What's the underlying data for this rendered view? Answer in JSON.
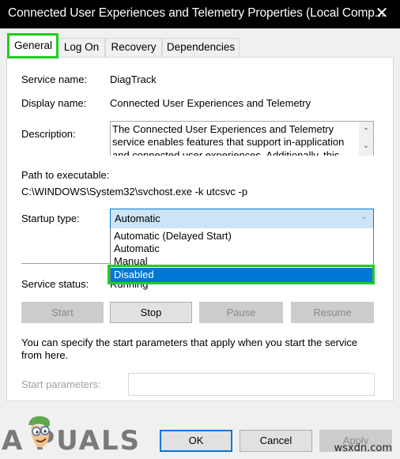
{
  "window": {
    "title": "Connected User Experiences and Telemetry Properties (Local Comp...",
    "close_icon": "close-icon"
  },
  "tabs": [
    {
      "label": "General",
      "active": true
    },
    {
      "label": "Log On",
      "active": false
    },
    {
      "label": "Recovery",
      "active": false
    },
    {
      "label": "Dependencies",
      "active": false
    }
  ],
  "general": {
    "service_name_label": "Service name:",
    "service_name_value": "DiagTrack",
    "display_name_label": "Display name:",
    "display_name_value": "Connected User Experiences and Telemetry",
    "description_label": "Description:",
    "description_value": "The Connected User Experiences and Telemetry service enables features that support in-application and connected user experiences. Additionally, this",
    "path_label": "Path to executable:",
    "path_value": "C:\\WINDOWS\\System32\\svchost.exe -k utcsvc -p",
    "startup_type_label": "Startup type:",
    "startup_type_value": "Automatic",
    "startup_options": [
      {
        "label": "Automatic (Delayed Start)",
        "selected": false
      },
      {
        "label": "Automatic",
        "selected": false
      },
      {
        "label": "Manual",
        "selected": false
      },
      {
        "label": "Disabled",
        "selected": true
      }
    ],
    "service_status_label": "Service status:",
    "service_status_value": "Running",
    "buttons": {
      "start": "Start",
      "stop": "Stop",
      "pause": "Pause",
      "resume": "Resume"
    },
    "params_hint": "You can specify the start parameters that apply when you start the service from here.",
    "start_params_label": "Start parameters:",
    "start_params_value": ""
  },
  "footer": {
    "ok": "OK",
    "cancel": "Cancel",
    "apply": "Apply"
  },
  "watermarks": {
    "brand": "A  PUALS",
    "site": "wsxdn.com"
  },
  "colors": {
    "highlight_green": "#22cc22",
    "selection_blue": "#0078d7",
    "combo_bg": "#cce4f7"
  }
}
